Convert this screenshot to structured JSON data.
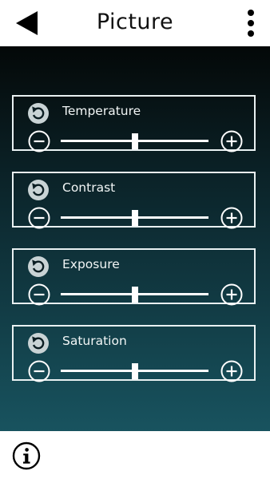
{
  "header": {
    "title": "Picture",
    "back_icon": "back-arrow-icon",
    "menu_icon": "more-vertical-icon"
  },
  "controls": [
    {
      "label": "Temperature",
      "value_percent": 50
    },
    {
      "label": "Contrast",
      "value_percent": 50
    },
    {
      "label": "Exposure",
      "value_percent": 50
    },
    {
      "label": "Saturation",
      "value_percent": 50
    }
  ],
  "footer": {
    "info_icon": "info-icon"
  },
  "colors": {
    "panel_top": "#040808",
    "panel_bottom": "#18535f",
    "control_foreground": "#ffffff"
  }
}
